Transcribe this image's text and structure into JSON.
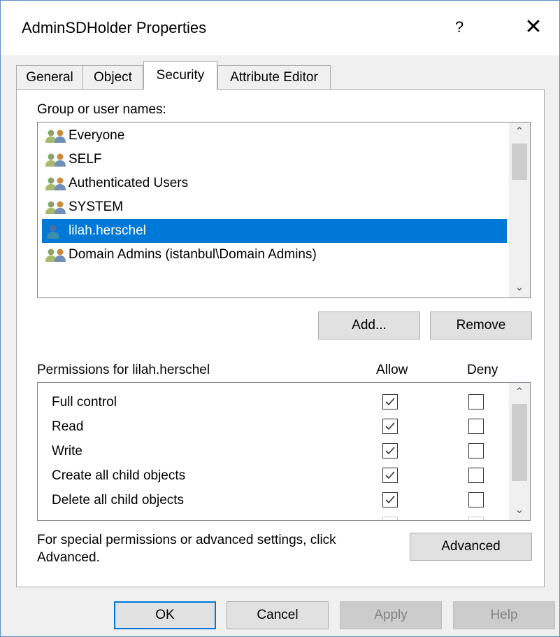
{
  "window": {
    "title": "AdminSDHolder Properties",
    "help_label": "?",
    "close_label": "✕"
  },
  "tabs": [
    {
      "label": "General"
    },
    {
      "label": "Object"
    },
    {
      "label": "Security"
    },
    {
      "label": "Attribute Editor"
    }
  ],
  "security": {
    "group_label": "Group or user names:",
    "principals": [
      {
        "name": "Everyone",
        "icon": "group-icon"
      },
      {
        "name": "SELF",
        "icon": "group-icon"
      },
      {
        "name": "Authenticated Users",
        "icon": "group-icon"
      },
      {
        "name": "SYSTEM",
        "icon": "group-icon"
      },
      {
        "name": "lilah.herschel",
        "icon": "user-icon",
        "selected": true
      },
      {
        "name": "Domain Admins (istanbul\\Domain Admins)",
        "icon": "group-icon"
      }
    ],
    "add_label": "Add...",
    "remove_label": "Remove",
    "permissions_label": "Permissions for lilah.herschel",
    "allow_label": "Allow",
    "deny_label": "Deny",
    "permissions": [
      {
        "name": "Full control",
        "allow": true,
        "deny": false
      },
      {
        "name": "Read",
        "allow": true,
        "deny": false
      },
      {
        "name": "Write",
        "allow": true,
        "deny": false
      },
      {
        "name": "Create all child objects",
        "allow": true,
        "deny": false
      },
      {
        "name": "Delete all child objects",
        "allow": true,
        "deny": false
      }
    ],
    "special_text_line1": "For special permissions or advanced settings, click",
    "special_text_line2": "Advanced.",
    "advanced_label": "Advanced"
  },
  "footer": {
    "ok_label": "OK",
    "cancel_label": "Cancel",
    "apply_label": "Apply",
    "help_label": "Help"
  },
  "colors": {
    "selection": "#0078d7",
    "dialog_border": "#5c8fc6",
    "client_bg": "#f0f0f0"
  }
}
